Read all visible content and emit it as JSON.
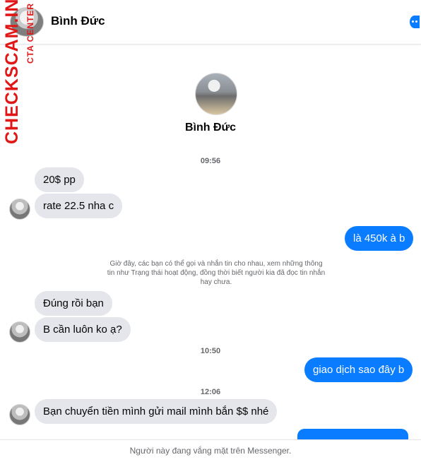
{
  "header": {
    "name": "Bình Đức"
  },
  "watermark": {
    "main": "CHECKSCAM.INFO",
    "sub": "CTA CENTER"
  },
  "profile": {
    "name": "Bình Đức"
  },
  "messages": {
    "time1": "09:56",
    "m1": "20$ pp",
    "m2": "rate 22.5 nha c",
    "m3": "là 450k à b",
    "system_note": "Giờ đây, các bạn có thể gọi và nhắn tin cho nhau, xem những thông tin như Trạng thái hoạt động, đồng thời biết người kia đã đọc tin nhắn hay chưa.",
    "m4": "Đúng rồi bạn",
    "m5": "B cần luôn ko ạ?",
    "time2": "10:50",
    "m6": "giao dịch sao đây b",
    "time3": "12:06",
    "m7": "Bạn chuyển tiền mình gửi mail mình bắn $$ nhé"
  },
  "footer": {
    "status": "Người này đang vắng mặt trên Messenger."
  },
  "icons": {
    "info": "info-icon"
  }
}
